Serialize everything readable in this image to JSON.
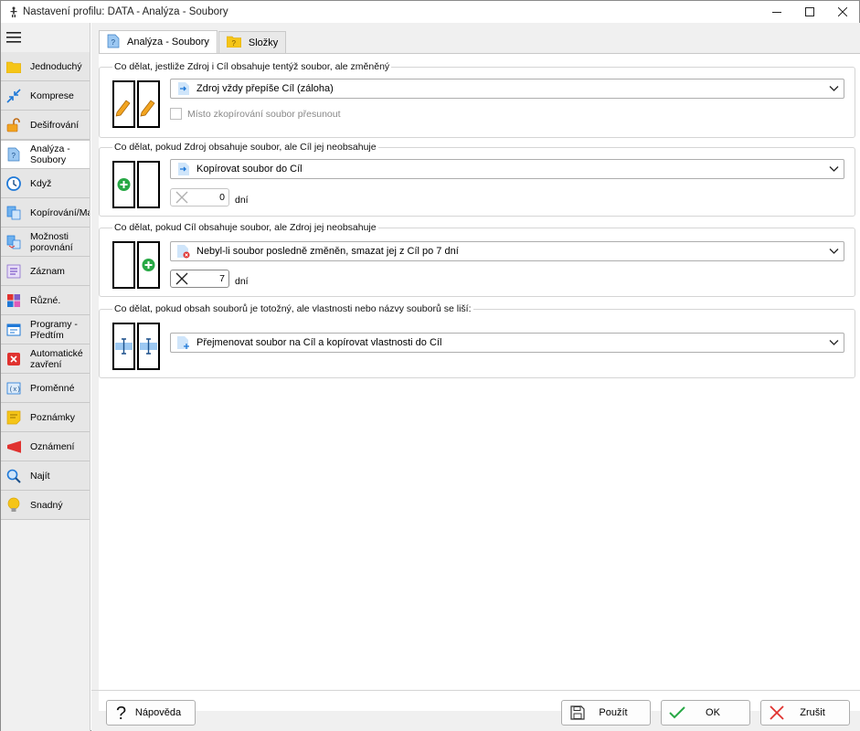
{
  "window": {
    "title": "Nastavení profilu: DATA - Analýza - Soubory"
  },
  "sidebar": {
    "items": [
      {
        "label": "Jednoduchý",
        "icon": "folder-icon"
      },
      {
        "label": "Komprese",
        "icon": "compress-arrows-icon"
      },
      {
        "label": "Dešifrování",
        "icon": "unlock-icon"
      },
      {
        "label": "Analýza -\nSoubory",
        "icon": "question-file-icon",
        "active": true
      },
      {
        "label": "Když",
        "icon": "clock-icon"
      },
      {
        "label": "Kopírování/Maz",
        "icon": "copy-files-icon"
      },
      {
        "label": "Možnosti\nporovnání",
        "icon": "compare-files-icon"
      },
      {
        "label": "Záznam",
        "icon": "log-list-icon"
      },
      {
        "label": "Různé.",
        "icon": "puzzle-icon"
      },
      {
        "label": "Programy -\nPředtím",
        "icon": "program-window-icon"
      },
      {
        "label": "Automatické\nzavření",
        "icon": "close-x-icon"
      },
      {
        "label": "Proměnné",
        "icon": "variable-icon"
      },
      {
        "label": "Poznámky",
        "icon": "note-icon"
      },
      {
        "label": "Oznámení",
        "icon": "megaphone-icon"
      },
      {
        "label": "Najít",
        "icon": "magnifier-icon"
      },
      {
        "label": "Snadný",
        "icon": "lightbulb-icon"
      }
    ]
  },
  "tabs": [
    {
      "label": "Analýza - Soubory",
      "active": true
    },
    {
      "label": "Složky",
      "active": false
    }
  ],
  "groups": {
    "changed": {
      "legend": "Co dělat, jestliže Zdroj i Cíl obsahuje tentýž soubor, ale změněný",
      "select_value": "Zdroj vždy přepíše Cíl (záloha)",
      "checkbox_label": "Místo zkopírování soubor přesunout",
      "checkbox_checked": false,
      "checkbox_enabled": false
    },
    "source_only": {
      "legend": "Co dělat, pokud Zdroj obsahuje soubor, ale Cíl jej neobsahuje",
      "select_value": "Kopírovat soubor do Cíl",
      "days_value": "0",
      "days_unit": "dní"
    },
    "target_only": {
      "legend": "Co dělat, pokud Cíl obsahuje soubor, ale Zdroj jej neobsahuje",
      "select_value": "Nebyl-li soubor posledně změněn, smazat jej z Cíl po 7 dní",
      "days_value": "7",
      "days_unit": "dní"
    },
    "identical": {
      "legend": "Co dělat, pokud obsah souborů je totožný, ale vlastnosti nebo názvy souborů se liší:",
      "select_value": "Přejmenovat soubor na Cíl a kopírovat vlastnosti do Cíl"
    }
  },
  "buttons": {
    "help": "Nápověda",
    "apply": "Použít",
    "ok": "OK",
    "cancel": "Zrušit"
  },
  "colors": {
    "accent_blue": "#1e78d7",
    "green": "#27a845",
    "red": "#e0322f",
    "pencil_orange": "#f2a420",
    "folder_yellow": "#f5c518"
  }
}
